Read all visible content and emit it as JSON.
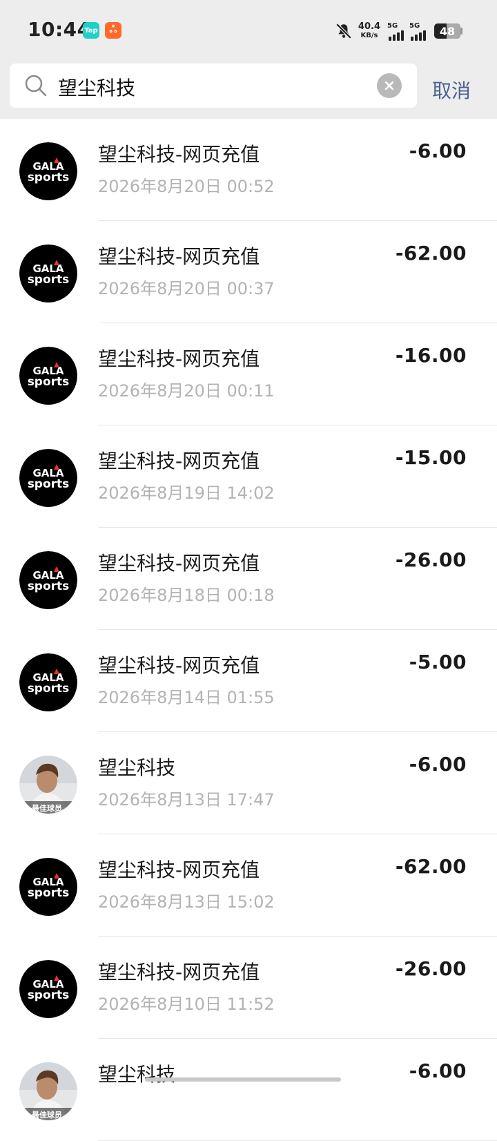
{
  "status_bar": {
    "time": "10:44",
    "app_badge_1": "Tap",
    "app_badge_2": "ஃ",
    "net_speed": "40.4",
    "net_unit": "KB/s",
    "signal_1": "5G",
    "signal_2": "5G",
    "battery": "48",
    "battery_level_percent": 48
  },
  "search": {
    "query": "望尘科技",
    "clear_label": "×",
    "cancel_label": "取消"
  },
  "avatar_logo": {
    "line1": "GALA",
    "line2": "sports"
  },
  "transactions": [
    {
      "title": "望尘科技-网页充值",
      "time": "2026年8月20日 00:52",
      "amount": "-6.00",
      "avatar": "gala"
    },
    {
      "title": "望尘科技-网页充值",
      "time": "2026年8月20日 00:37",
      "amount": "-62.00",
      "avatar": "gala"
    },
    {
      "title": "望尘科技-网页充值",
      "time": "2026年8月20日 00:11",
      "amount": "-16.00",
      "avatar": "gala"
    },
    {
      "title": "望尘科技-网页充值",
      "time": "2026年8月19日 14:02",
      "amount": "-15.00",
      "avatar": "gala"
    },
    {
      "title": "望尘科技-网页充值",
      "time": "2026年8月18日 00:18",
      "amount": "-26.00",
      "avatar": "gala"
    },
    {
      "title": "望尘科技-网页充值",
      "time": "2026年8月14日 01:55",
      "amount": "-5.00",
      "avatar": "gala"
    },
    {
      "title": "望尘科技",
      "time": "2026年8月13日 17:47",
      "amount": "-6.00",
      "avatar": "photo"
    },
    {
      "title": "望尘科技-网页充值",
      "time": "2026年8月13日 15:02",
      "amount": "-62.00",
      "avatar": "gala"
    },
    {
      "title": "望尘科技-网页充值",
      "time": "2026年8月10日 11:52",
      "amount": "-26.00",
      "avatar": "gala"
    },
    {
      "title": "望尘科技",
      "time": "",
      "amount": "-6.00",
      "avatar": "photo"
    }
  ],
  "photo_avatar_caption": "最佳球员",
  "colors": {
    "header_bg": "#ededed",
    "cancel": "#4a6190",
    "time_text": "#b3b3b3",
    "logo_red": "#e8322f"
  }
}
